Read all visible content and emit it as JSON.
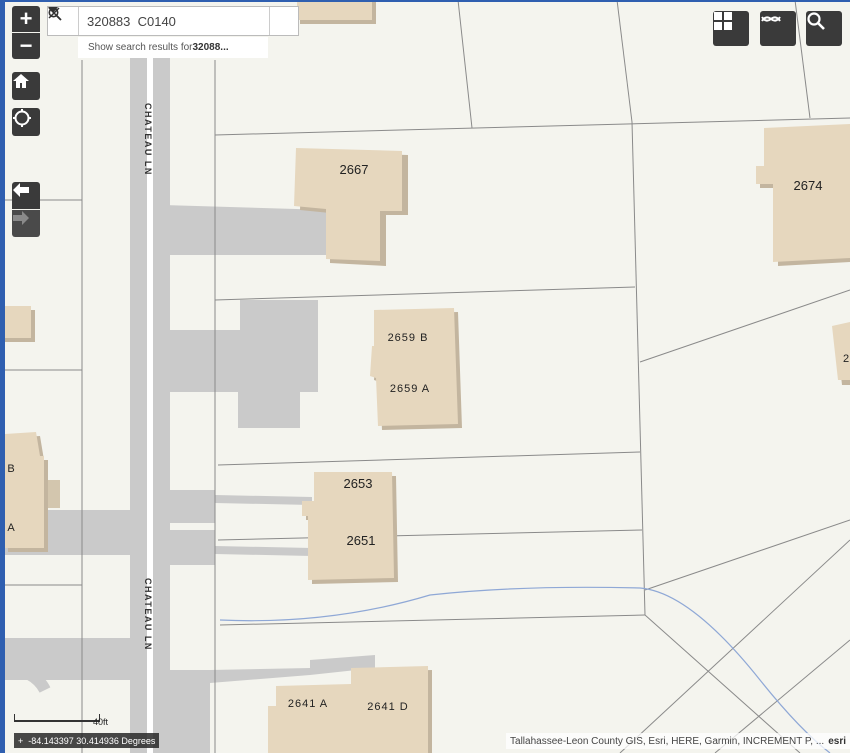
{
  "search": {
    "value": "320883  C0140",
    "suggestion_prefix": "Show search results for ",
    "suggestion_term": "32088..."
  },
  "controls": {
    "zoom_in": "+",
    "zoom_out": "−"
  },
  "street_labels": [
    "CHATEAU LN",
    "CHATEAU LN"
  ],
  "building_labels": [
    "2667",
    "2674",
    "2659 B",
    "2659 A",
    "2653",
    "2651",
    "2641 A",
    "2641 D",
    "B",
    "A",
    "2"
  ],
  "scale": {
    "label": "40ft"
  },
  "coordinates": {
    "text": "-84.143397 30.414936 Degrees"
  },
  "attribution": {
    "text": "Tallahassee-Leon County GIS, Esri, HERE, Garmin, INCREMENT P, ...",
    "logo": "esri"
  },
  "colors": {
    "background": "#f4f4ee",
    "building_fill": "#e6d7be",
    "building_shadow": "#c3b59f",
    "pavement": "#c9c9c9",
    "road": "#cacaca",
    "parcel_line": "#8a8a8a",
    "water_line": "#8fa8d6",
    "control_bg": "#3a3a3a"
  }
}
